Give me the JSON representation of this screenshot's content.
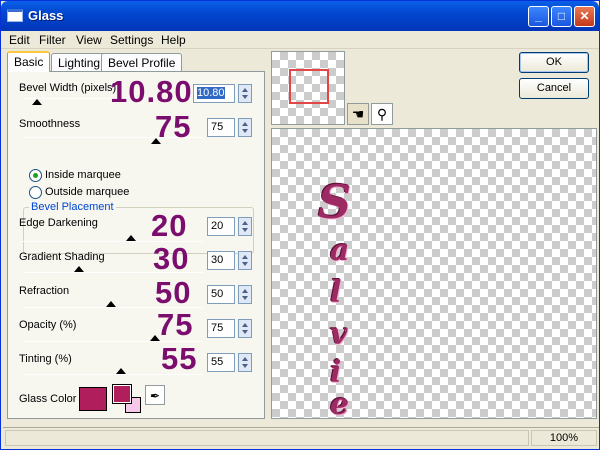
{
  "window": {
    "title": "Glass",
    "minimize_label": "_",
    "maximize_label": "□",
    "close_label": "✕"
  },
  "menu": [
    "Edit",
    "Filter",
    "View",
    "Settings",
    "Help"
  ],
  "tabs": [
    "Basic",
    "Lighting",
    "Bevel Profile"
  ],
  "basic": {
    "bevel_width": {
      "label": "Bevel Width (pixels)",
      "value": "10.80",
      "overlay": "10.80"
    },
    "smoothness": {
      "label": "Smoothness",
      "value": "75",
      "overlay": "75"
    },
    "bevel_placement": {
      "title": "Bevel Placement",
      "inside": "Inside marquee",
      "outside": "Outside marquee",
      "selected": "inside"
    },
    "edge_darkening": {
      "label": "Edge Darkening",
      "value": "20",
      "overlay": "20"
    },
    "gradient_shading": {
      "label": "Gradient Shading",
      "value": "30",
      "overlay": "30"
    },
    "refraction": {
      "label": "Refraction",
      "value": "50",
      "overlay": "50"
    },
    "opacity": {
      "label": "Opacity (%)",
      "value": "75",
      "overlay": "75"
    },
    "tinting": {
      "label": "Tinting (%)",
      "value": "55",
      "overlay": "55"
    },
    "glass_color": {
      "label": "Glass Color",
      "color": "#b01e5c",
      "secondary": "#f7c8ea"
    }
  },
  "buttons": {
    "ok": "OK",
    "cancel": "Cancel"
  },
  "preview": {
    "text": [
      "S",
      "a",
      "l",
      "v",
      "i",
      "e"
    ],
    "text_color": "#9c2a63"
  },
  "status": {
    "zoom": "100%"
  }
}
